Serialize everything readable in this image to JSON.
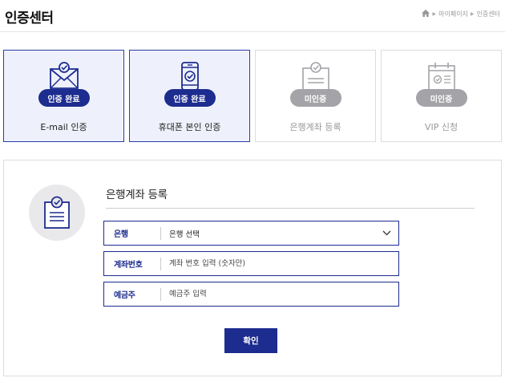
{
  "header": {
    "title": "인증센터",
    "breadcrumb": {
      "items": [
        "마이페이지",
        "인증센터"
      ]
    }
  },
  "steps": [
    {
      "label": "E-mail 인증",
      "badge": "인증 완료",
      "status": "done",
      "icon": "envelope-check-icon"
    },
    {
      "label": "휴대폰 본인 인증",
      "badge": "인증 완료",
      "status": "done",
      "icon": "phone-check-icon"
    },
    {
      "label": "은행계좌 등록",
      "badge": "미인증",
      "status": "pending",
      "icon": "bank-document-check-icon"
    },
    {
      "label": "VIP 신청",
      "badge": "미인증",
      "status": "pending",
      "icon": "calendar-check-icon"
    }
  ],
  "form": {
    "title": "은행계좌 등록",
    "icon": "document-check-icon",
    "bank": {
      "label": "은행",
      "value": "은행 선택"
    },
    "account": {
      "label": "계좌번호",
      "placeholder": "계좌 번호 입력 (숫자만)"
    },
    "holder": {
      "label": "예금주",
      "placeholder": "예금주 입력"
    },
    "submit_label": "확인"
  },
  "colors": {
    "accent": "#1d2c8f",
    "done_bg": "#eef1fb",
    "pending_badge": "#a4a4a8",
    "border": "#dddddd"
  }
}
